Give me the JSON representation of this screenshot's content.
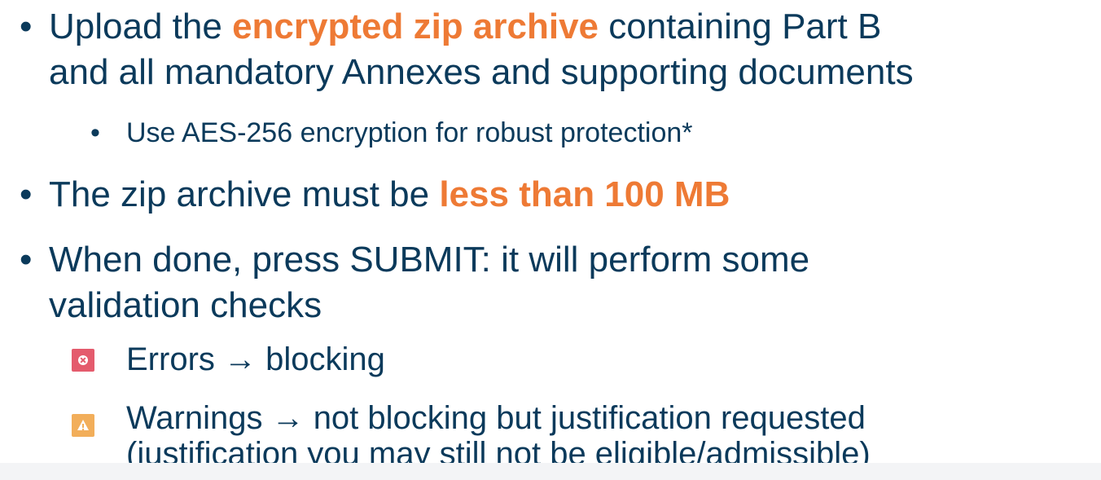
{
  "bullets": {
    "b1": {
      "prefix": "Upload the ",
      "highlight": "encrypted zip archive",
      "suffix": " containing Part B",
      "line2": "and all mandatory Annexes and supporting documents"
    },
    "b1_sub": "Use AES-256 encryption for robust protection*",
    "b2": {
      "prefix": "The zip archive must be ",
      "highlight": "less than 100 MB"
    },
    "b3": {
      "line1": "When done, press SUBMIT: it will perform some",
      "line2": "validation checks"
    }
  },
  "status_items": {
    "error": {
      "text": "Errors → blocking",
      "icon": "error-icon"
    },
    "warning": {
      "line1": "Warnings → not blocking but justification requested",
      "line2": "(justification you may still not be eligible/admissible)",
      "icon": "warning-icon"
    }
  },
  "colors": {
    "text": "#0b3a5b",
    "highlight": "#ee7a35",
    "error": "#e45b6d",
    "warning": "#f2ae5a"
  },
  "bullet_glyph": "•"
}
